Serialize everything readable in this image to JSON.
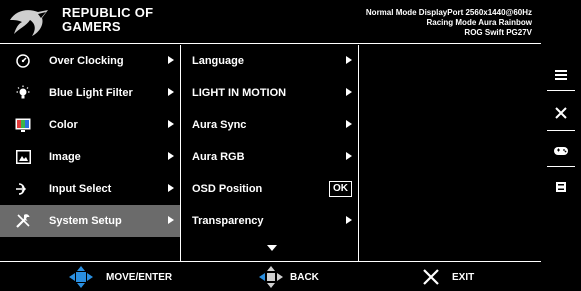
{
  "header": {
    "brand_line1": "REPUBLIC OF",
    "brand_line2": "GAMERS",
    "status_line1": "Normal Mode DisplayPort 2560x1440@60Hz",
    "status_line2": "Racing Mode Aura Rainbow",
    "status_line3": "ROG Swift PG27V"
  },
  "main_menu": [
    {
      "label": "Over Clocking",
      "icon": "speedometer-icon"
    },
    {
      "label": "Blue Light Filter",
      "icon": "bulb-icon"
    },
    {
      "label": "Color",
      "icon": "color-monitor-icon"
    },
    {
      "label": "Image",
      "icon": "image-icon"
    },
    {
      "label": "Input Select",
      "icon": "input-icon"
    },
    {
      "label": "System Setup",
      "icon": "tools-icon",
      "selected": true
    }
  ],
  "submenu": [
    {
      "label": "Language"
    },
    {
      "label": "LIGHT IN MOTION"
    },
    {
      "label": "Aura Sync"
    },
    {
      "label": "Aura RGB"
    },
    {
      "label": "OSD Position",
      "button": "OK"
    },
    {
      "label": "Transparency"
    }
  ],
  "footer": {
    "move_label": "MOVE/ENTER",
    "back_label": "BACK",
    "exit_label": "EXIT"
  },
  "side_buttons": [
    "menu-icon",
    "close-icon",
    "gamepad-icon",
    "gameplus-icon"
  ],
  "colors": {
    "background": "#000000",
    "text": "#ffffff",
    "selected_row": "#6b6b6b",
    "nav_blue": "#2a8fe0"
  }
}
